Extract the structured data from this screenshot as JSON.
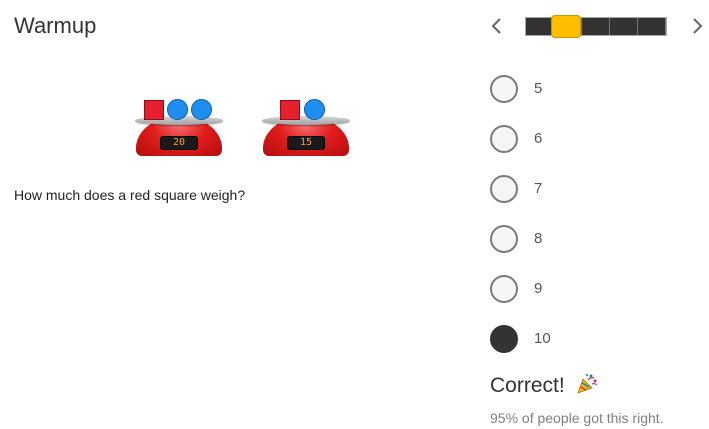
{
  "header": {
    "title": "Warmup"
  },
  "scales": [
    {
      "reading": "20",
      "items": [
        "square",
        "circle",
        "circle"
      ]
    },
    {
      "reading": "15",
      "items": [
        "square",
        "circle"
      ]
    }
  ],
  "question": "How much does a red square weigh?",
  "progress": {
    "total_steps": 5,
    "current_step": 1
  },
  "options": [
    "5",
    "6",
    "7",
    "8",
    "9",
    "10"
  ],
  "selected_option": "10",
  "feedback": {
    "result": "Correct!",
    "stat": "95% of people got this right."
  },
  "colors": {
    "accent": "#ffbf00",
    "square": "#e4202f",
    "circle": "#1e8ef0",
    "scale": "#e11c1c"
  },
  "icons": {
    "prev": "chevron-left-icon",
    "next": "chevron-right-icon",
    "celebrate": "party-popper-icon"
  }
}
